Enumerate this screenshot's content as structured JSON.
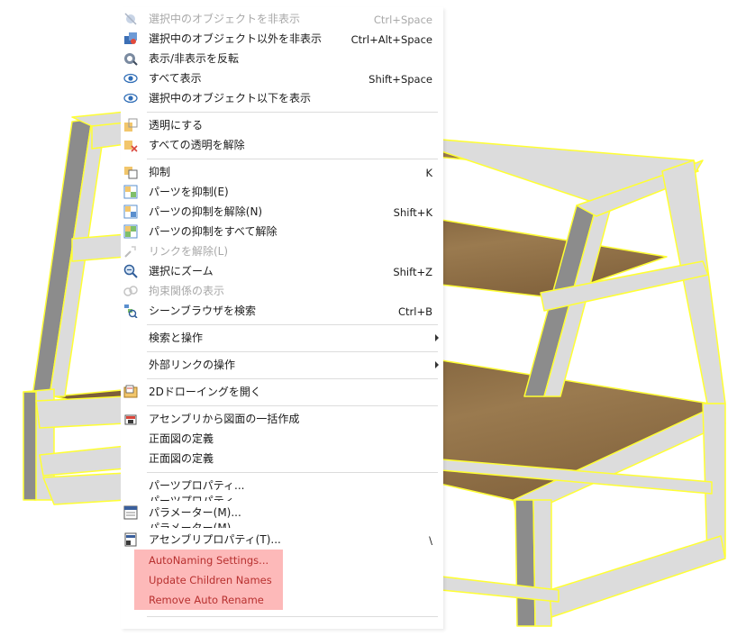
{
  "menu": {
    "items": [
      {
        "label": "選択中のオブジェクトを非表示",
        "shortcut": "Ctrl+Space",
        "icon": "hide-icon",
        "disabled": true
      },
      {
        "label": "選択中のオブジェクト以外を非表示",
        "shortcut": "Ctrl+Alt+Space",
        "icon": "hide-others-icon",
        "disabled": false
      },
      {
        "label": "表示/非表示を反転",
        "shortcut": "",
        "icon": "invert-visibility-icon",
        "disabled": false
      },
      {
        "label": "すべて表示",
        "shortcut": "Shift+Space",
        "icon": "eye-icon",
        "disabled": false
      },
      {
        "label": "選択中のオブジェクト以下を表示",
        "shortcut": "",
        "icon": "eye-icon",
        "disabled": false
      },
      {
        "label": "透明にする",
        "shortcut": "",
        "icon": "transparent-icon",
        "disabled": false
      },
      {
        "label": "すべての透明を解除",
        "shortcut": "",
        "icon": "remove-transparency-icon",
        "disabled": false
      },
      {
        "label": "抑制",
        "shortcut": "K",
        "icon": "suppress-icon",
        "disabled": false
      },
      {
        "label": "パーツを抑制(E)",
        "shortcut": "",
        "icon": "suppress-part-icon",
        "disabled": false
      },
      {
        "label": "パーツの抑制を解除(N)",
        "shortcut": "Shift+K",
        "icon": "unsuppress-part-icon",
        "disabled": false
      },
      {
        "label": "パーツの抑制をすべて解除",
        "shortcut": "",
        "icon": "unsuppress-all-icon",
        "disabled": false
      },
      {
        "label": "リンクを解除(L)",
        "shortcut": "",
        "icon": "unlink-icon",
        "disabled": true
      },
      {
        "label": "選択にズーム",
        "shortcut": "Shift+Z",
        "icon": "zoom-icon",
        "disabled": false
      },
      {
        "label": "拘束関係の表示",
        "shortcut": "",
        "icon": "constraint-icon",
        "disabled": true
      },
      {
        "label": "シーンブラウザを検索",
        "shortcut": "Ctrl+B",
        "icon": "scene-browser-search-icon",
        "disabled": false
      },
      {
        "label": "検索と操作",
        "submenu": true
      },
      {
        "label": "外部リンクの操作",
        "submenu": true
      },
      {
        "label": "2Dドローイングを開く",
        "shortcut": "",
        "icon": "drawing-icon",
        "disabled": false
      },
      {
        "label": "アセンブリから図面の一括作成",
        "shortcut": "",
        "icon": "batch-drawing-icon",
        "disabled": false
      },
      {
        "label": "正面図の定義",
        "shortcut": "",
        "icon": "",
        "disabled": false
      },
      {
        "label": "正面図の定義",
        "shortcut": "",
        "icon": "",
        "disabled": false
      },
      {
        "label": "パーツプロパティ...",
        "shortcut": "",
        "icon": "",
        "disabled": false
      },
      {
        "label": "パラメーター(M)...",
        "shortcut": "",
        "icon": "parameter-icon",
        "disabled": false
      },
      {
        "label": "アセンブリプロパティ(T)...",
        "shortcut": "\\",
        "icon": "assembly-property-icon",
        "disabled": false
      },
      {
        "label": "AutoNaming Settings...",
        "plugin": true
      },
      {
        "label": "Update Children Names",
        "plugin": true
      },
      {
        "label": "Remove Auto Rename",
        "plugin": true
      }
    ],
    "ghosts": [
      "パーツプロパティ...",
      "パラメーター(M)..."
    ]
  },
  "colors": {
    "highlight": "#fdb9b9",
    "plugin_text": "#b8302f",
    "edge": "#ffff33",
    "wood": "#8a6840",
    "frame": "#dcdcdc"
  }
}
